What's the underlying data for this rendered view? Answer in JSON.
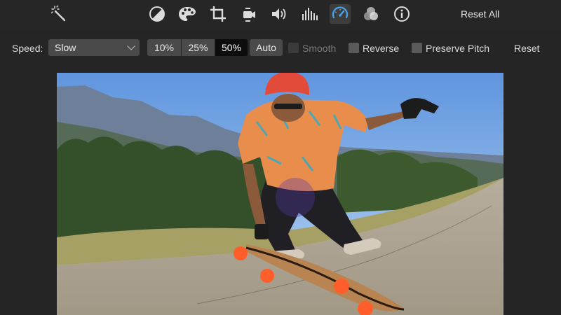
{
  "toolbar": {
    "icons": [
      "magic-wand-icon",
      "color-balance-icon",
      "color-palette-icon",
      "crop-icon",
      "stabilization-icon",
      "volume-icon",
      "equalizer-icon",
      "speed-icon",
      "noise-reduction-icon",
      "info-icon"
    ],
    "active_icon": "speed-icon",
    "reset_all_label": "Reset All",
    "active_color": "#4aa3f0"
  },
  "speed": {
    "label": "Speed:",
    "select_value": "Slow",
    "presets": [
      "10%",
      "25%",
      "50%"
    ],
    "selected_preset": "50%",
    "auto_label": "Auto",
    "smooth_label": "Smooth",
    "smooth_enabled": false,
    "reverse_label": "Reverse",
    "preserve_pitch_label": "Preserve Pitch",
    "reset_label": "Reset"
  },
  "viewer": {
    "content": "skateboarder-video-frame"
  }
}
